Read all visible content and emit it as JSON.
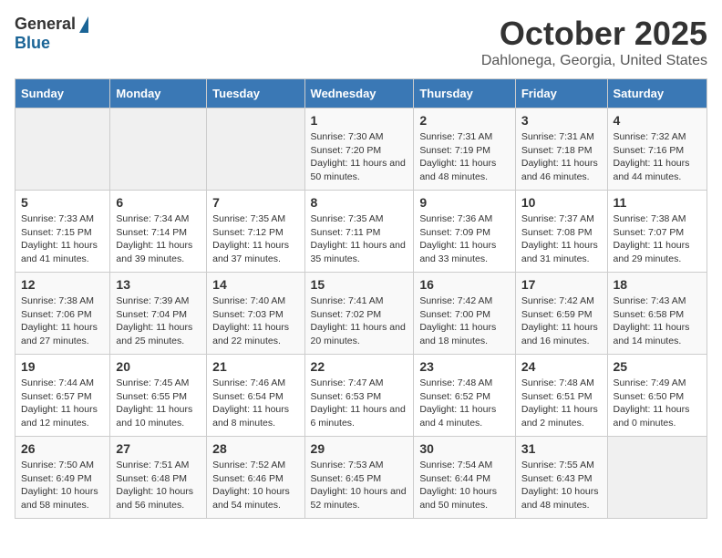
{
  "logo": {
    "general": "General",
    "blue": "Blue"
  },
  "title": "October 2025",
  "subtitle": "Dahlonega, Georgia, United States",
  "days_of_week": [
    "Sunday",
    "Monday",
    "Tuesday",
    "Wednesday",
    "Thursday",
    "Friday",
    "Saturday"
  ],
  "weeks": [
    [
      {
        "day": "",
        "info": ""
      },
      {
        "day": "",
        "info": ""
      },
      {
        "day": "",
        "info": ""
      },
      {
        "day": "1",
        "info": "Sunrise: 7:30 AM\nSunset: 7:20 PM\nDaylight: 11 hours and 50 minutes."
      },
      {
        "day": "2",
        "info": "Sunrise: 7:31 AM\nSunset: 7:19 PM\nDaylight: 11 hours and 48 minutes."
      },
      {
        "day": "3",
        "info": "Sunrise: 7:31 AM\nSunset: 7:18 PM\nDaylight: 11 hours and 46 minutes."
      },
      {
        "day": "4",
        "info": "Sunrise: 7:32 AM\nSunset: 7:16 PM\nDaylight: 11 hours and 44 minutes."
      }
    ],
    [
      {
        "day": "5",
        "info": "Sunrise: 7:33 AM\nSunset: 7:15 PM\nDaylight: 11 hours and 41 minutes."
      },
      {
        "day": "6",
        "info": "Sunrise: 7:34 AM\nSunset: 7:14 PM\nDaylight: 11 hours and 39 minutes."
      },
      {
        "day": "7",
        "info": "Sunrise: 7:35 AM\nSunset: 7:12 PM\nDaylight: 11 hours and 37 minutes."
      },
      {
        "day": "8",
        "info": "Sunrise: 7:35 AM\nSunset: 7:11 PM\nDaylight: 11 hours and 35 minutes."
      },
      {
        "day": "9",
        "info": "Sunrise: 7:36 AM\nSunset: 7:09 PM\nDaylight: 11 hours and 33 minutes."
      },
      {
        "day": "10",
        "info": "Sunrise: 7:37 AM\nSunset: 7:08 PM\nDaylight: 11 hours and 31 minutes."
      },
      {
        "day": "11",
        "info": "Sunrise: 7:38 AM\nSunset: 7:07 PM\nDaylight: 11 hours and 29 minutes."
      }
    ],
    [
      {
        "day": "12",
        "info": "Sunrise: 7:38 AM\nSunset: 7:06 PM\nDaylight: 11 hours and 27 minutes."
      },
      {
        "day": "13",
        "info": "Sunrise: 7:39 AM\nSunset: 7:04 PM\nDaylight: 11 hours and 25 minutes."
      },
      {
        "day": "14",
        "info": "Sunrise: 7:40 AM\nSunset: 7:03 PM\nDaylight: 11 hours and 22 minutes."
      },
      {
        "day": "15",
        "info": "Sunrise: 7:41 AM\nSunset: 7:02 PM\nDaylight: 11 hours and 20 minutes."
      },
      {
        "day": "16",
        "info": "Sunrise: 7:42 AM\nSunset: 7:00 PM\nDaylight: 11 hours and 18 minutes."
      },
      {
        "day": "17",
        "info": "Sunrise: 7:42 AM\nSunset: 6:59 PM\nDaylight: 11 hours and 16 minutes."
      },
      {
        "day": "18",
        "info": "Sunrise: 7:43 AM\nSunset: 6:58 PM\nDaylight: 11 hours and 14 minutes."
      }
    ],
    [
      {
        "day": "19",
        "info": "Sunrise: 7:44 AM\nSunset: 6:57 PM\nDaylight: 11 hours and 12 minutes."
      },
      {
        "day": "20",
        "info": "Sunrise: 7:45 AM\nSunset: 6:55 PM\nDaylight: 11 hours and 10 minutes."
      },
      {
        "day": "21",
        "info": "Sunrise: 7:46 AM\nSunset: 6:54 PM\nDaylight: 11 hours and 8 minutes."
      },
      {
        "day": "22",
        "info": "Sunrise: 7:47 AM\nSunset: 6:53 PM\nDaylight: 11 hours and 6 minutes."
      },
      {
        "day": "23",
        "info": "Sunrise: 7:48 AM\nSunset: 6:52 PM\nDaylight: 11 hours and 4 minutes."
      },
      {
        "day": "24",
        "info": "Sunrise: 7:48 AM\nSunset: 6:51 PM\nDaylight: 11 hours and 2 minutes."
      },
      {
        "day": "25",
        "info": "Sunrise: 7:49 AM\nSunset: 6:50 PM\nDaylight: 11 hours and 0 minutes."
      }
    ],
    [
      {
        "day": "26",
        "info": "Sunrise: 7:50 AM\nSunset: 6:49 PM\nDaylight: 10 hours and 58 minutes."
      },
      {
        "day": "27",
        "info": "Sunrise: 7:51 AM\nSunset: 6:48 PM\nDaylight: 10 hours and 56 minutes."
      },
      {
        "day": "28",
        "info": "Sunrise: 7:52 AM\nSunset: 6:46 PM\nDaylight: 10 hours and 54 minutes."
      },
      {
        "day": "29",
        "info": "Sunrise: 7:53 AM\nSunset: 6:45 PM\nDaylight: 10 hours and 52 minutes."
      },
      {
        "day": "30",
        "info": "Sunrise: 7:54 AM\nSunset: 6:44 PM\nDaylight: 10 hours and 50 minutes."
      },
      {
        "day": "31",
        "info": "Sunrise: 7:55 AM\nSunset: 6:43 PM\nDaylight: 10 hours and 48 minutes."
      },
      {
        "day": "",
        "info": ""
      }
    ]
  ]
}
